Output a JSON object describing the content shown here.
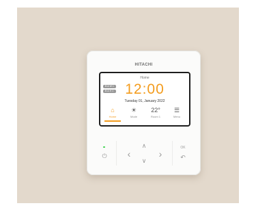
{
  "brand": "HITACHI",
  "screen": {
    "title": "Home",
    "badges": [
      "B & W 1",
      "B & H 1"
    ],
    "time": "12:00",
    "date": "Tuesday 01, January 2022",
    "tabs": [
      {
        "label": "Home",
        "icon": "⌂",
        "active": true
      },
      {
        "label": "Mode",
        "icon": "☀"
      },
      {
        "label": "Room 1",
        "icon": "22°"
      },
      {
        "label": "Menu",
        "icon": "☰"
      }
    ]
  },
  "keys": {
    "power": "⏻",
    "left": "‹",
    "up": "∧",
    "down": "∨",
    "right": "›",
    "ok": "OK",
    "back": "↶"
  },
  "colors": {
    "accent": "#f39c1e",
    "led": "#3bd14a",
    "wall": "#e3d9cc"
  }
}
